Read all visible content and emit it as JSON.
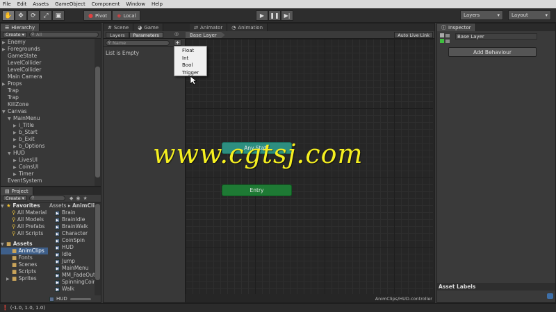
{
  "menubar": [
    "File",
    "Edit",
    "Assets",
    "GameObject",
    "Component",
    "Window",
    "Help"
  ],
  "toolbar": {
    "tools": [
      "hand-icon",
      "move-icon",
      "rotate-icon",
      "scale-icon",
      "rect-icon"
    ],
    "pivot": "Pivot",
    "local": "Local",
    "layers": "Layers",
    "layout": "Layout"
  },
  "hierarchy": {
    "tab": "Hierarchy",
    "create": "Create",
    "search_placeholder": "All",
    "items": [
      {
        "label": "Enemy",
        "depth": 0,
        "expandable": true,
        "expanded": false
      },
      {
        "label": "Foregrounds",
        "depth": 0,
        "expandable": true,
        "expanded": false
      },
      {
        "label": "GameState",
        "depth": 0,
        "expandable": false
      },
      {
        "label": "LevelCollider",
        "depth": 0,
        "expandable": false
      },
      {
        "label": "LevelCollider",
        "depth": 0,
        "expandable": false
      },
      {
        "label": "Main Camera",
        "depth": 0,
        "expandable": false
      },
      {
        "label": "Props",
        "depth": 0,
        "expandable": true,
        "expanded": false
      },
      {
        "label": "Trap",
        "depth": 0,
        "expandable": false
      },
      {
        "label": "Trap",
        "depth": 0,
        "expandable": false
      },
      {
        "label": "KillZone",
        "depth": 0,
        "expandable": false
      },
      {
        "label": "Canvas",
        "depth": 0,
        "expandable": true,
        "expanded": true
      },
      {
        "label": "MainMenu",
        "depth": 1,
        "expandable": true,
        "expanded": true
      },
      {
        "label": "i_Title",
        "depth": 2,
        "expandable": true,
        "expanded": false
      },
      {
        "label": "b_Start",
        "depth": 2,
        "expandable": true,
        "expanded": false
      },
      {
        "label": "b_Exit",
        "depth": 2,
        "expandable": true,
        "expanded": false
      },
      {
        "label": "b_Options",
        "depth": 2,
        "expandable": true,
        "expanded": false
      },
      {
        "label": "HUD",
        "depth": 1,
        "expandable": true,
        "expanded": true
      },
      {
        "label": "LivesUI",
        "depth": 2,
        "expandable": true,
        "expanded": false
      },
      {
        "label": "CoinsUI",
        "depth": 2,
        "expandable": true,
        "expanded": false
      },
      {
        "label": "Timer",
        "depth": 2,
        "expandable": true,
        "expanded": false
      },
      {
        "label": "EventSystem",
        "depth": 0,
        "expandable": false
      }
    ]
  },
  "project": {
    "tab": "Project",
    "create": "Create",
    "favorites_label": "Favorites",
    "favorites": [
      "All Material",
      "All Models",
      "All Prefabs",
      "All Scripts"
    ],
    "assets_label": "Assets",
    "folders": [
      {
        "label": "AnimClips",
        "selected": true,
        "expandable": false
      },
      {
        "label": "Fonts",
        "selected": false,
        "expandable": false
      },
      {
        "label": "Scenes",
        "selected": false,
        "expandable": false
      },
      {
        "label": "Scripts",
        "selected": false,
        "expandable": false
      },
      {
        "label": "Sprites",
        "selected": false,
        "expandable": true
      }
    ],
    "breadcrumb_root": "Assets",
    "breadcrumb_sep": "▸",
    "breadcrumb_current": "AnimClips",
    "files": [
      "Brain",
      "BrainIdle",
      "BrainWalk",
      "Character",
      "CoinSpin",
      "HUD",
      "Idle",
      "Jump",
      "MainMenu",
      "MM_FadeOut",
      "SpinningCoin_C",
      "Walk"
    ],
    "footer_item": "HUD"
  },
  "center_tabs": {
    "scene": "Scene",
    "game": "Game",
    "animator": "Animator",
    "animation": "Animation"
  },
  "animator": {
    "layers_tab": "Layers",
    "parameters_tab": "Parameters",
    "breadcrumb": "Base Layer",
    "auto_live_link": "Auto Live Link",
    "param_search_placeholder": "Name",
    "add_label": "+",
    "list_empty": "List is Empty",
    "menu": [
      "Float",
      "Int",
      "Bool",
      "Trigger"
    ],
    "states": [
      {
        "label": "Any State",
        "color": "#2d8e80"
      },
      {
        "label": "Entry",
        "color": "#1e7a34"
      }
    ],
    "footer_path": "AnimClips/HUD.controller",
    "watermark": "www.cgtsj.com"
  },
  "inspector": {
    "tab": "Inspector",
    "layer_name": "Base Layer",
    "add_behaviour": "Add Behaviour",
    "asset_labels": "Asset Labels"
  },
  "status": {
    "text": "(-1.0, 1.0, 1.0)"
  }
}
